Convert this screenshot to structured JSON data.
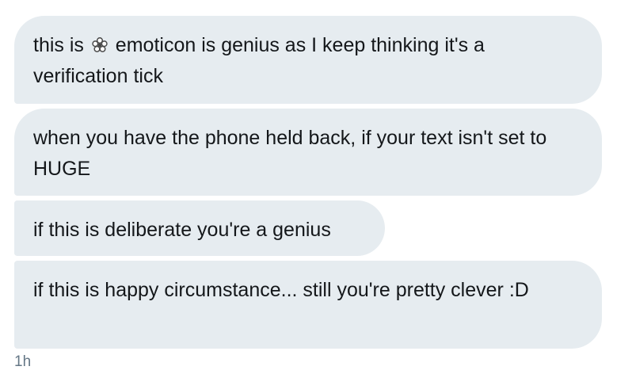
{
  "messages": [
    {
      "text_before": "this is ",
      "icon": "flower-emoticon-icon",
      "text_after": " emoticon is genius as I keep thinking it's a verification tick"
    },
    {
      "text": "when you have the phone held back, if your text isn't set to HUGE"
    },
    {
      "text": "if this is deliberate you're a genius"
    },
    {
      "text": "if this is happy circumstance... still you're pretty clever :D"
    }
  ],
  "timestamp": "1h",
  "colors": {
    "bubble_bg": "#e6ecf0",
    "text": "#14171a",
    "timestamp": "#657786"
  }
}
